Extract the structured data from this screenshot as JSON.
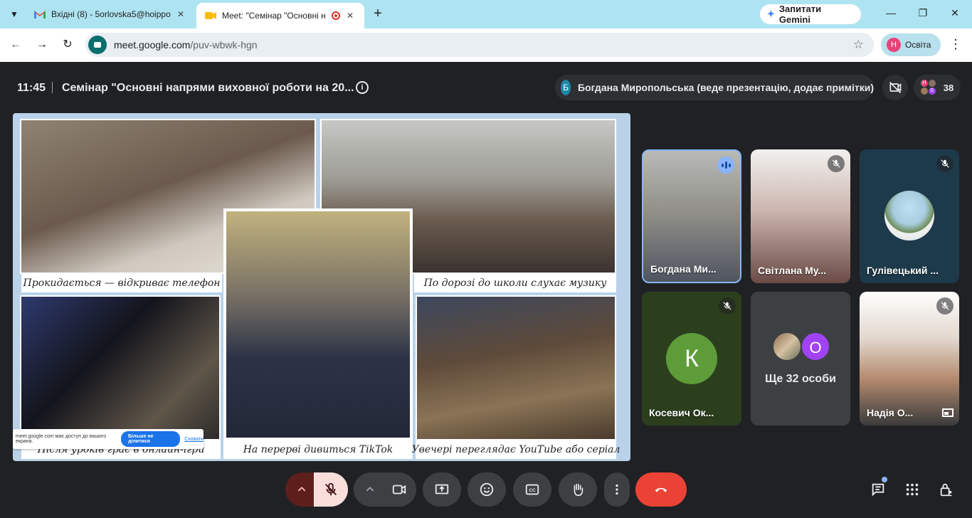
{
  "browser": {
    "tabs": [
      {
        "title": "Вхідні (8) - 5orlovska5@hoippo",
        "icon": "gmail-icon"
      },
      {
        "title": "Meet: \"Семінар \"Основні н",
        "icon": "meet-icon"
      }
    ],
    "gemini_label": "Запитати Gemini",
    "url_host": "meet.google.com",
    "url_path": "/puv-wbwk-hgn",
    "profile_initial": "Н",
    "profile_label": "Освіта"
  },
  "meeting": {
    "time": "11:45",
    "title": "Семінар \"Основні напрями виховної роботи на 20...",
    "presenter_initial": "Б",
    "presenter_text": "Богдана Миропольська (веде презентацію, додає примітки)",
    "participant_count": "38",
    "mini_avatar_letters": [
      "Н",
      "S"
    ]
  },
  "slide": {
    "captions": [
      "Прокидається — відкриває телефон",
      "По дорозі до школи слухає музику",
      "Після уроків грає в онлайн-ігри",
      "На перерві дивиться TikTok",
      "Увечері переглядає YouTube або серіал"
    ],
    "share_notice": {
      "text": "meet.google.com має доступ до вашого екрана.",
      "stop_label": "Більше не ділитися",
      "hide_label": "Сховати"
    }
  },
  "participants": [
    {
      "name": "Богдана Ми...",
      "state": "speaking"
    },
    {
      "name": "Світлана Му...",
      "state": "muted"
    },
    {
      "name": "Гулівецький ...",
      "state": "muted"
    },
    {
      "name": "Косевич Ок...",
      "state": "muted",
      "initial": "К"
    },
    {
      "name": "Ще 32 особи",
      "state": "group",
      "initial": "О"
    },
    {
      "name": "Надія О...",
      "state": "muted"
    }
  ],
  "colors": {
    "background": "#202124",
    "accent_blue": "#8ab4f8",
    "hangup_red": "#ea4335",
    "mic_muted_bg": "#f9dedc"
  }
}
